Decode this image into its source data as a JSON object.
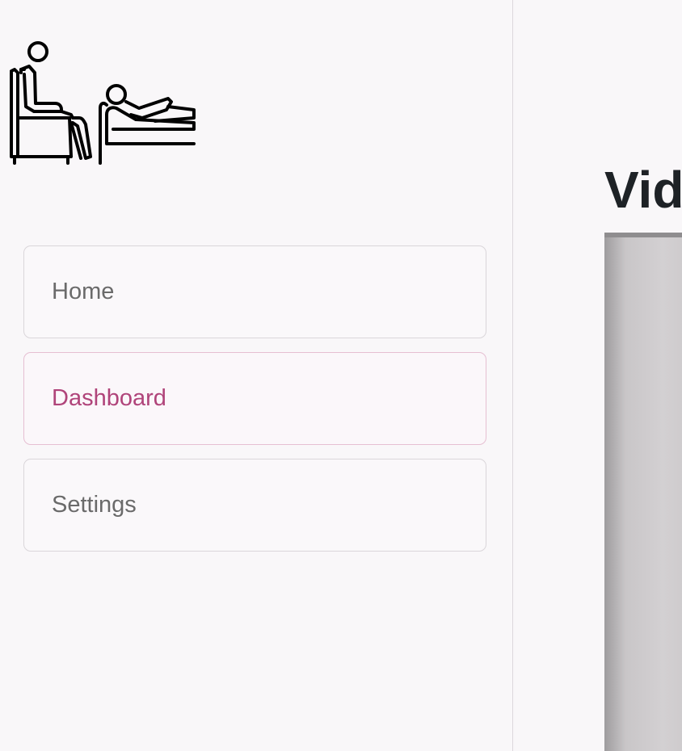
{
  "sidebar": {
    "logo_icon": "therapy-session-icon",
    "nav": [
      {
        "label": "Home",
        "active": false
      },
      {
        "label": "Dashboard",
        "active": true
      },
      {
        "label": "Settings",
        "active": false
      }
    ]
  },
  "main": {
    "title": "Vid"
  },
  "colors": {
    "accent": "#b0447a",
    "accent_border": "#e6bfd2",
    "text_muted": "#6a6a6a",
    "title": "#1e2226",
    "background": "#f9f7f9"
  }
}
